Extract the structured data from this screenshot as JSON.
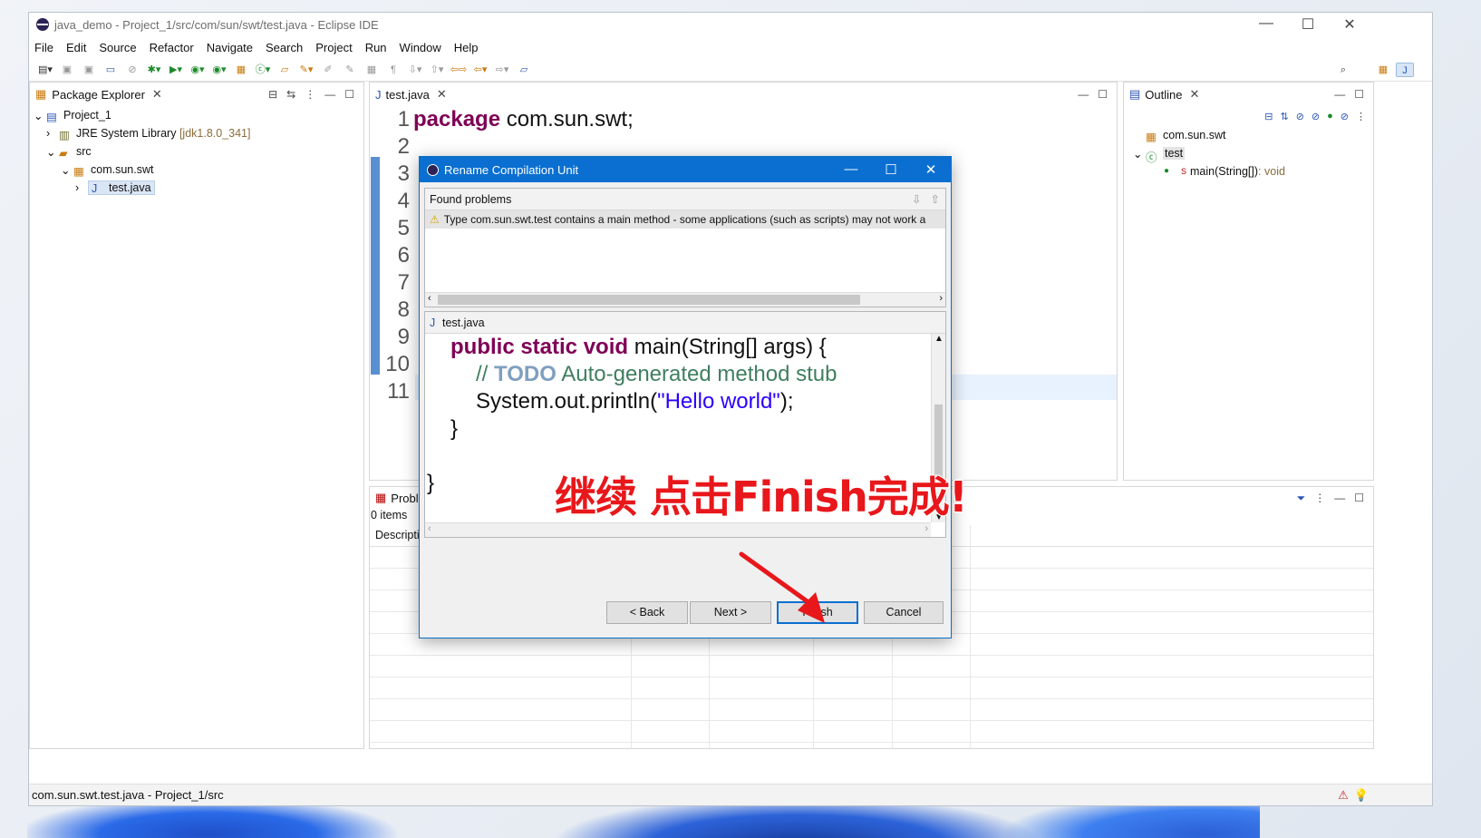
{
  "window": {
    "title": "java_demo - Project_1/src/com/sun/swt/test.java - Eclipse IDE",
    "controls": {
      "minimize": "—",
      "maximize": "☐",
      "close": "✕"
    }
  },
  "menu": [
    "File",
    "Edit",
    "Source",
    "Refactor",
    "Navigate",
    "Search",
    "Project",
    "Run",
    "Window",
    "Help"
  ],
  "package_explorer": {
    "tab": "Package Explorer",
    "tree": {
      "project": "Project_1",
      "jre": "JRE System Library",
      "jre_version": "[jdk1.8.0_341]",
      "src": "src",
      "package": "com.sun.swt",
      "file": "test.java"
    }
  },
  "editor": {
    "tab": "test.java",
    "line_numbers": [
      "1",
      "2",
      "3",
      "4",
      "5",
      "6",
      "7",
      "8",
      "9",
      "10",
      "11"
    ],
    "line1_kw": "package",
    "line1_rest": " com.sun.swt;"
  },
  "outline": {
    "tab": "Outline",
    "package": "com.sun.swt",
    "class": "test",
    "method": "main(String[])",
    "method_type": " : void",
    "static_marker": "S"
  },
  "problems": {
    "tab": "Proble",
    "count": "0 items",
    "col_description": "Descripti"
  },
  "dialog": {
    "title": "Rename Compilation Unit",
    "found_problems": "Found problems",
    "problem_message": "Type com.sun.swt.test contains a main method - some applications (such as scripts) may not work a",
    "preview_file": "test.java",
    "code": {
      "l1_kw": "public static void",
      "l1_rest": " main(String[] args) {",
      "l2_slash": "// ",
      "l2_todo": "TODO",
      "l2_rest": " Auto-generated method stub",
      "l3_a": "System.out.println(",
      "l3_str": "\"Hello world\"",
      "l3_b": ");",
      "l4": "}",
      "l5": "}"
    },
    "buttons": {
      "back": "< Back",
      "next": "Next >",
      "finish": "Finish",
      "cancel": "Cancel"
    }
  },
  "annotation": "继续 点击Finish完成!",
  "status": "com.sun.swt.test.java - Project_1/src",
  "colors": {
    "accent": "#0a6fd0",
    "annotation": "#e8171b",
    "keyword": "#7f0055"
  }
}
